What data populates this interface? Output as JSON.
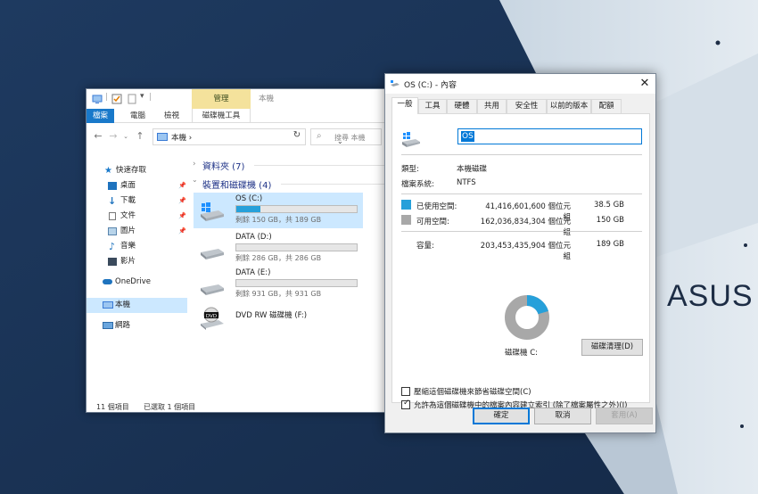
{
  "desktop": {
    "brand": "ASUS"
  },
  "explorer": {
    "ribbon": {
      "tabs": [
        "檔案",
        "電腦",
        "檢視"
      ],
      "context_group": "管理",
      "context_tab": "磁碟機工具",
      "window_title": "本機"
    },
    "address": {
      "crumbs": "本機  ›",
      "search_placeholder": "搜尋 本機"
    },
    "nav": [
      {
        "label": "快速存取",
        "icon": "star-icon"
      },
      {
        "label": "桌面",
        "icon": "desktop-icon",
        "pinned": true
      },
      {
        "label": "下載",
        "icon": "download-icon",
        "pinned": true
      },
      {
        "label": "文件",
        "icon": "document-icon",
        "pinned": true
      },
      {
        "label": "圖片",
        "icon": "picture-icon",
        "pinned": true
      },
      {
        "label": "音樂",
        "icon": "music-icon"
      },
      {
        "label": "影片",
        "icon": "video-icon"
      },
      {
        "label": "OneDrive",
        "icon": "cloud-icon"
      },
      {
        "label": "本機",
        "icon": "computer-icon",
        "selected": true
      },
      {
        "label": "網路",
        "icon": "network-icon"
      }
    ],
    "groups": {
      "folders": "資料夾 (7)",
      "devices": "裝置和磁碟機 (4)"
    },
    "drives": [
      {
        "name": "OS (C:)",
        "free": "剩餘 150 GB，共 189 GB",
        "used_fraction": 0.2,
        "selected": true
      },
      {
        "name": "DATA (D:)",
        "free": "剩餘 286 GB，共 286 GB",
        "used_fraction": 0.0
      },
      {
        "name": "DATA (E:)",
        "free": "剩餘 931 GB，共 931 GB",
        "used_fraction": 0.0
      },
      {
        "name": "DVD RW 磁碟機 (F:)"
      }
    ],
    "status": {
      "items": "11 個項目",
      "selected": "已選取 1 個項目"
    }
  },
  "properties": {
    "title": "OS (C:) - 內容",
    "tabs": [
      "一般",
      "工具",
      "硬體",
      "共用",
      "安全性",
      "以前的版本",
      "配額"
    ],
    "name_value": "OS",
    "type_label": "類型:",
    "type_value": "本機磁碟",
    "fs_label": "檔案系統:",
    "fs_value": "NTFS",
    "used": {
      "label": "已使用空間:",
      "bytes": "41,416,601,600 個位元組",
      "size": "38.5 GB",
      "color": "#26a0da"
    },
    "free": {
      "label": "可用空間:",
      "bytes": "162,036,834,304 個位元組",
      "size": "150 GB",
      "color": "#a8a8a8"
    },
    "capacity": {
      "label": "容量:",
      "bytes": "203,453,435,904 個位元組",
      "size": "189 GB"
    },
    "used_fraction": 0.2036,
    "drive_label": "磁碟機 C:",
    "cleanup_button": "磁碟清理(D)",
    "compress_label": "壓縮這個磁碟機來節省磁碟空間(C)",
    "compress_checked": false,
    "index_label": "允許為這個磁碟機中的檔案內容建立索引 (除了檔案屬性之外)(I)",
    "index_checked": true,
    "buttons": {
      "ok": "確定",
      "cancel": "取消",
      "apply": "套用(A)"
    }
  }
}
